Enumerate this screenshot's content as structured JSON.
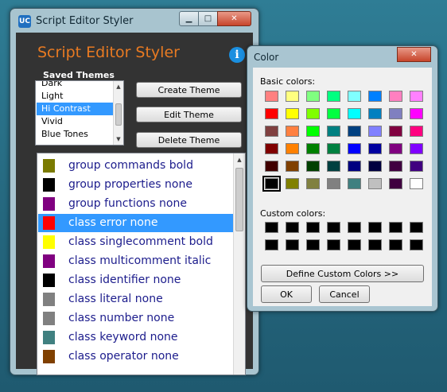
{
  "window": {
    "title": "Script Editor Styler",
    "app_icon": "UC",
    "minimize_symbol": "▁",
    "maximize_symbol": "□",
    "close_symbol": "✕"
  },
  "main": {
    "heading": "Script Editor Styler",
    "info_symbol": "i",
    "saved_themes": {
      "label": "Saved Themes",
      "items": [
        "Dark",
        "Light",
        "Hi Contrast",
        "Vivid",
        "Blue Tones"
      ],
      "selected": "Hi Contrast"
    },
    "buttons": {
      "create": "Create Theme",
      "edit": "Edit Theme",
      "delete": "Delete Theme"
    },
    "styles": [
      {
        "text": "group commands bold",
        "color": "#7a7a00"
      },
      {
        "text": "group properties none",
        "color": "#000000"
      },
      {
        "text": "group functions none",
        "color": "#800080"
      },
      {
        "text": "class error none",
        "color": "#ff0000",
        "selected": true
      },
      {
        "text": "class singlecomment bold",
        "color": "#ffff00"
      },
      {
        "text": "class multicomment italic",
        "color": "#800080"
      },
      {
        "text": "class identifier none",
        "color": "#000000"
      },
      {
        "text": "class literal none",
        "color": "#808080"
      },
      {
        "text": "class number none",
        "color": "#808080"
      },
      {
        "text": "class keyword none",
        "color": "#408080"
      },
      {
        "text": "class operator none",
        "color": "#804000"
      }
    ]
  },
  "color_dialog": {
    "title": "Color",
    "close_symbol": "✕",
    "basic_label": "Basic colors:",
    "custom_label": "Custom colors:",
    "basic_colors": [
      [
        "#ff8080",
        "#ffff80",
        "#80ff80",
        "#00ff80",
        "#80ffff",
        "#0080ff",
        "#ff80c0",
        "#ff80ff"
      ],
      [
        "#ff0000",
        "#ffff00",
        "#80ff00",
        "#00ff40",
        "#00ffff",
        "#0080c0",
        "#8080c0",
        "#ff00ff"
      ],
      [
        "#804040",
        "#ff8040",
        "#00ff00",
        "#008080",
        "#004080",
        "#8080ff",
        "#800040",
        "#ff0080"
      ],
      [
        "#800000",
        "#ff8000",
        "#008000",
        "#008040",
        "#0000ff",
        "#0000a0",
        "#800080",
        "#8000ff"
      ],
      [
        "#400000",
        "#804000",
        "#004000",
        "#004040",
        "#000080",
        "#000040",
        "#400040",
        "#400080"
      ],
      [
        "#000000",
        "#808000",
        "#808040",
        "#808080",
        "#408080",
        "#c0c0c0",
        "#400040",
        "#ffffff"
      ]
    ],
    "selected_cell": "5,0",
    "custom_colors": [
      [
        "#000000",
        "#000000",
        "#000000",
        "#000000",
        "#000000",
        "#000000",
        "#000000",
        "#000000"
      ],
      [
        "#000000",
        "#000000",
        "#000000",
        "#000000",
        "#000000",
        "#000000",
        "#000000",
        "#000000"
      ]
    ],
    "define_custom": "Define Custom Colors >>",
    "ok": "OK",
    "cancel": "Cancel"
  }
}
